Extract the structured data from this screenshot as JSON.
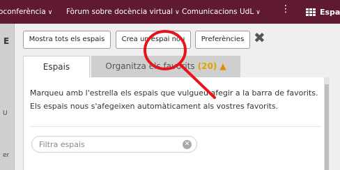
{
  "topbar": {
    "items": [
      "oconferència",
      "Fòrum sobre docència virtual",
      "Comunicacions UdL"
    ],
    "more_glyph": "⋮",
    "spaces_label": "Espa"
  },
  "background": {
    "letter_e": "E",
    "letter_u": "U",
    "letter_er": "er"
  },
  "toolbar": {
    "show_all": "Mostra tots els espais",
    "create_new": "Crea un espai nou",
    "preferences": "Preferències",
    "close_glyph": "✖"
  },
  "tabs": {
    "spaces": "Espais",
    "organize": "Organitza els favorits",
    "organize_count": "(20)",
    "warning_glyph": "▲"
  },
  "content": {
    "intro_line1": "Marqueu amb l'estrella els espais que vulgueu afegir a la barra de favorits.",
    "intro_line2": "Els espais nous s'afegeixen automàticament als vostres favorits."
  },
  "filter": {
    "placeholder": "Filtra espais",
    "clear_glyph": "✕"
  },
  "colors": {
    "topbar": "#5f1930",
    "annotation": "#e8141b",
    "count": "#e0a100"
  }
}
